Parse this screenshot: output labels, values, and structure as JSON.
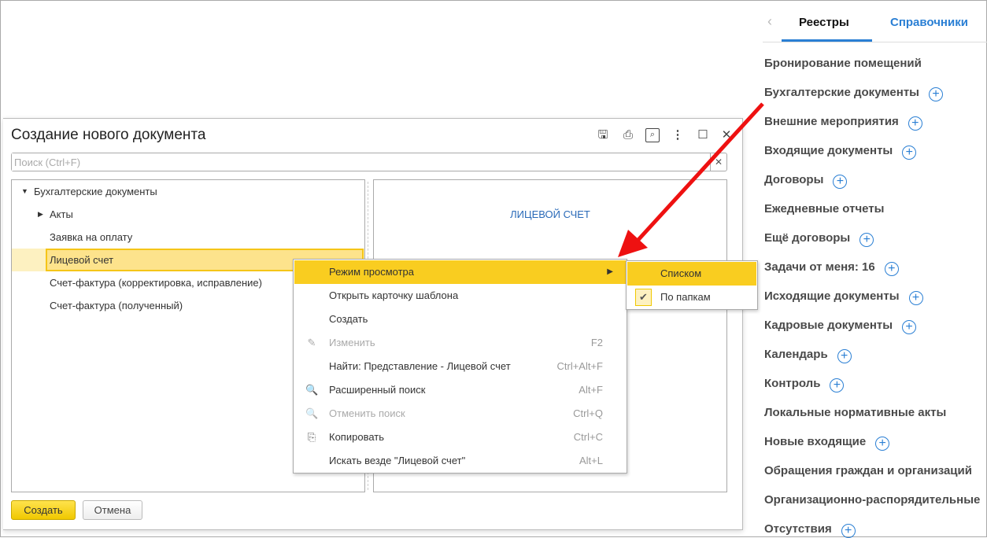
{
  "dialog": {
    "title": "Создание нового документа",
    "search_placeholder": "Поиск (Ctrl+F)",
    "tree": [
      {
        "label": "Бухгалтерские документы",
        "expanded": true
      },
      {
        "label": "Акты",
        "collapsed": true
      },
      {
        "label": "Заявка на оплату"
      },
      {
        "label": "Лицевой счет",
        "selected": true
      },
      {
        "label": "Счет-фактура (корректировка, исправление)"
      },
      {
        "label": "Счет-фактура (полученный)"
      }
    ],
    "preview_text": "ЛИЦЕВОЙ СЧЕТ",
    "create_label": "Создать",
    "cancel_label": "Отмена"
  },
  "menu": [
    {
      "label": "Режим просмотра",
      "shortcut": "",
      "highlighted": true
    },
    {
      "label": "Открыть карточку шаблона",
      "shortcut": ""
    },
    {
      "label": "Создать",
      "shortcut": ""
    },
    {
      "label": "Изменить",
      "shortcut": "F2",
      "disabled": true
    },
    {
      "label": "Найти: Представление - Лицевой счет",
      "shortcut": "Ctrl+Alt+F"
    },
    {
      "label": "Расширенный поиск",
      "shortcut": "Alt+F"
    },
    {
      "label": "Отменить поиск",
      "shortcut": "Ctrl+Q",
      "disabled": true
    },
    {
      "label": "Копировать",
      "shortcut": "Ctrl+C"
    },
    {
      "label": "Искать везде \"Лицевой счет\"",
      "shortcut": "Alt+L"
    }
  ],
  "submenu": [
    {
      "label": "Списком",
      "highlighted": true
    },
    {
      "label": "По папкам",
      "checked": true
    }
  ],
  "right": {
    "tabs": [
      "Реестры",
      "Справочники"
    ],
    "items": [
      "Бронирование помещений",
      "Бухгалтерские документы",
      "Внешние мероприятия",
      "Входящие документы",
      "Договоры",
      "Ежедневные отчеты",
      "Ещё договоры",
      "Задачи от меня: 16",
      "Исходящие документы",
      "Кадровые документы",
      "Календарь",
      "Контроль",
      "Локальные нормативные акты",
      "Новые входящие",
      "Обращения граждан и организаций",
      "Организационно-распорядительные",
      "Отсутствия"
    ]
  },
  "colors": {
    "accent": "#f9cd20",
    "link": "#2a7fd4",
    "arrow": "#ee1111"
  }
}
